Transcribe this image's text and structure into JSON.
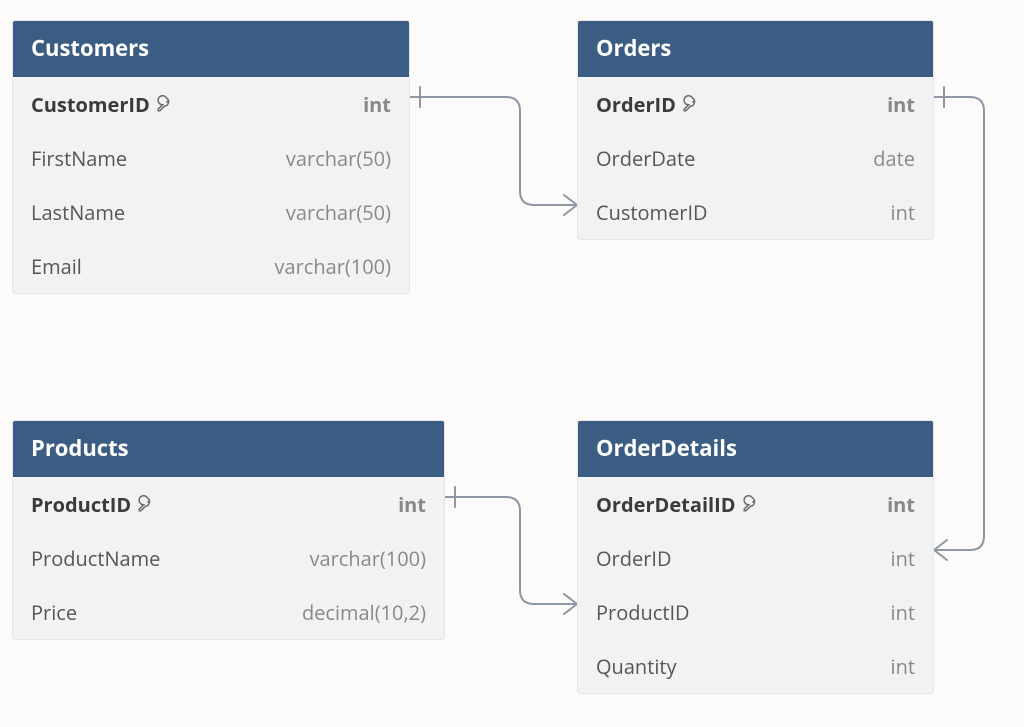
{
  "tables": {
    "customers": {
      "name": "Customers",
      "columns": [
        {
          "name": "CustomerID",
          "type": "int",
          "pk": true
        },
        {
          "name": "FirstName",
          "type": "varchar(50)"
        },
        {
          "name": "LastName",
          "type": "varchar(50)"
        },
        {
          "name": "Email",
          "type": "varchar(100)"
        }
      ]
    },
    "orders": {
      "name": "Orders",
      "columns": [
        {
          "name": "OrderID",
          "type": "int",
          "pk": true
        },
        {
          "name": "OrderDate",
          "type": "date"
        },
        {
          "name": "CustomerID",
          "type": "int"
        }
      ]
    },
    "products": {
      "name": "Products",
      "columns": [
        {
          "name": "ProductID",
          "type": "int",
          "pk": true
        },
        {
          "name": "ProductName",
          "type": "varchar(100)"
        },
        {
          "name": "Price",
          "type": "decimal(10,2)"
        }
      ]
    },
    "orderdetails": {
      "name": "OrderDetails",
      "columns": [
        {
          "name": "OrderDetailID",
          "type": "int",
          "pk": true
        },
        {
          "name": "OrderID",
          "type": "int"
        },
        {
          "name": "ProductID",
          "type": "int"
        },
        {
          "name": "Quantity",
          "type": "int"
        }
      ]
    }
  },
  "relationships": [
    {
      "from": "Customers.CustomerID",
      "to": "Orders.CustomerID",
      "type": "one-to-many"
    },
    {
      "from": "Orders.OrderID",
      "to": "OrderDetails.OrderID",
      "type": "one-to-many"
    },
    {
      "from": "Products.ProductID",
      "to": "OrderDetails.ProductID",
      "type": "one-to-many"
    }
  ]
}
